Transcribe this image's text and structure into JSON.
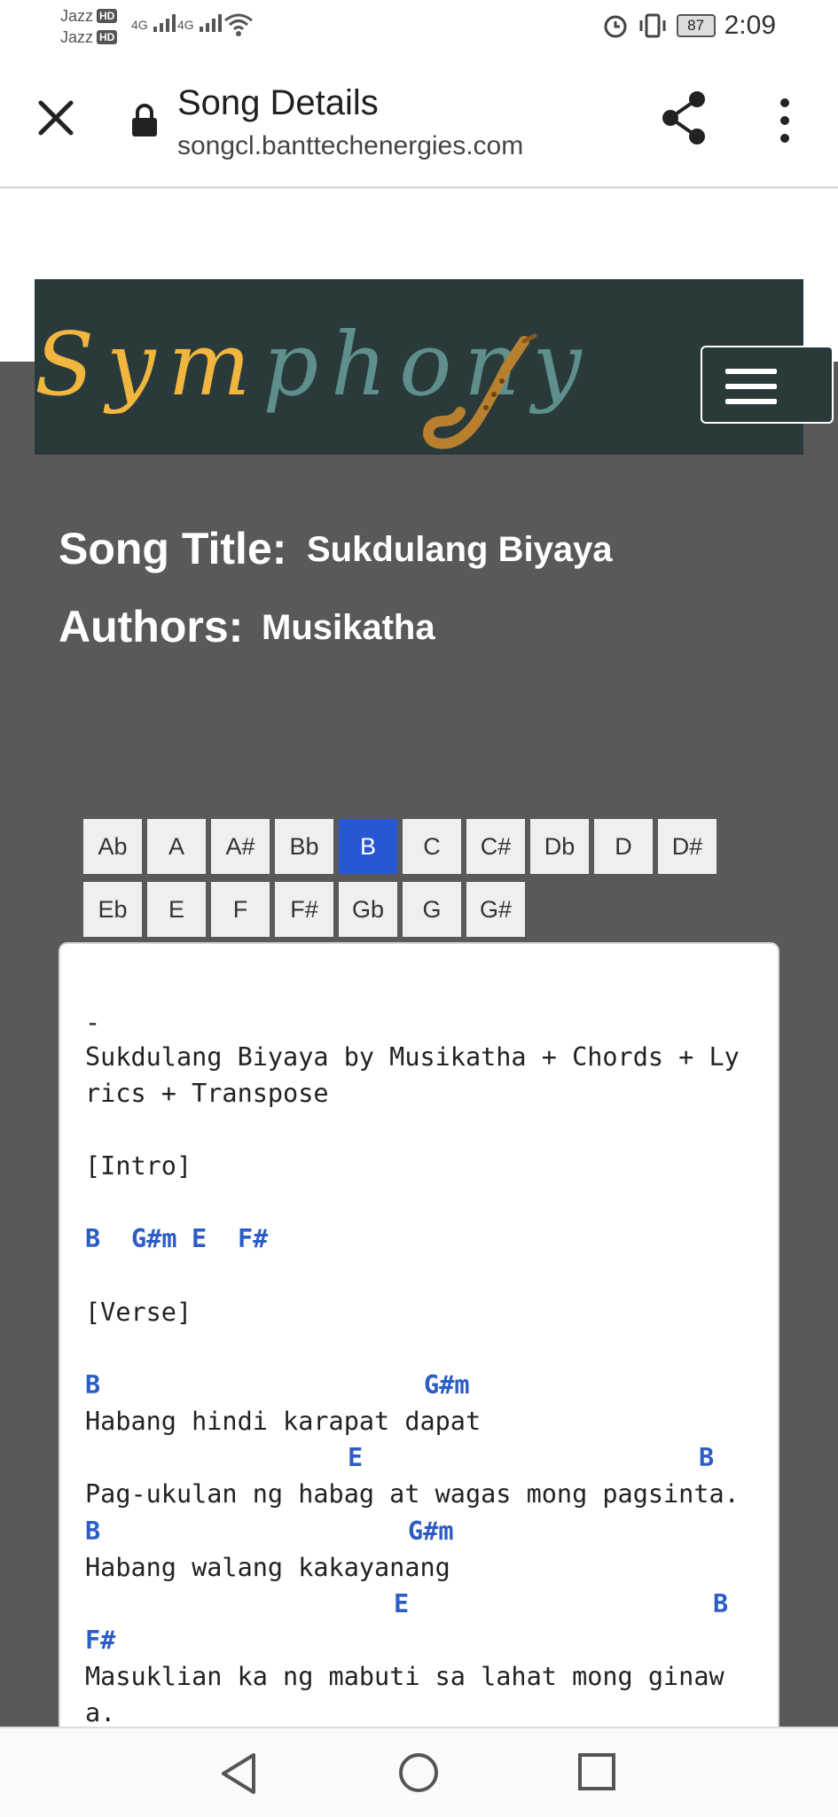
{
  "status_bar": {
    "carrier_1": "Jazz",
    "carrier_2": "Jazz",
    "hd": "HD",
    "net": "4G",
    "battery": "87",
    "time": "2:09",
    "icons": [
      "signal-icon",
      "wifi-icon",
      "alarm-icon",
      "vibrate-icon",
      "battery-icon"
    ]
  },
  "browser": {
    "title": "Song Details",
    "url": "songcl.banttechenergies.com",
    "icons": [
      "close-icon",
      "lock-icon",
      "share-icon",
      "more-vert-icon"
    ]
  },
  "brand": {
    "part1": "Sym",
    "part2": "phony",
    "colors": {
      "gold": "#f0b63e",
      "teal": "#5e8f8c",
      "navbar_bg": "#2a3a3b"
    }
  },
  "song": {
    "title_label": "Song Title:",
    "title": "Sukdulang Biyaya",
    "authors_label": "Authors:",
    "authors": "Musikatha"
  },
  "keys": {
    "row1": [
      "Ab",
      "A",
      "A#",
      "Bb",
      "B",
      "C",
      "C#",
      "Db",
      "D",
      "D#"
    ],
    "row2": [
      "Eb",
      "E",
      "F",
      "F#",
      "Gb",
      "G",
      "G#"
    ],
    "selected": "B",
    "accent": "#2857d4"
  },
  "sheet": {
    "dash": "-",
    "heading_1": "Sukdulang Biyaya by Musikatha + Chords + Ly",
    "heading_2": "rics + Transpose",
    "intro_label": "[Intro]",
    "intro_chords": [
      "B",
      "G#m",
      "E",
      "F#"
    ],
    "verse_label": "[Verse]",
    "chord_line_1": [
      "B",
      "G#m"
    ],
    "lyric_1": "Habang hindi karapat dapat",
    "chord_line_2": [
      "E",
      "B"
    ],
    "lyric_2": "Pag-ukulan ng habag at wagas mong pagsinta.",
    "chord_line_3": [
      "B",
      "G#m"
    ],
    "lyric_3": "Habang walang kakayanang",
    "chord_line_4": [
      "E",
      "B"
    ],
    "chord_line_5": [
      "F#"
    ],
    "lyric_4a": "Masuklian ka ng mabuti sa lahat mong ginaw",
    "lyric_4b": "a.",
    "chord_color": "#2c5cc5"
  },
  "nav": {
    "icons": [
      "back-icon",
      "home-icon",
      "recents-icon"
    ]
  }
}
